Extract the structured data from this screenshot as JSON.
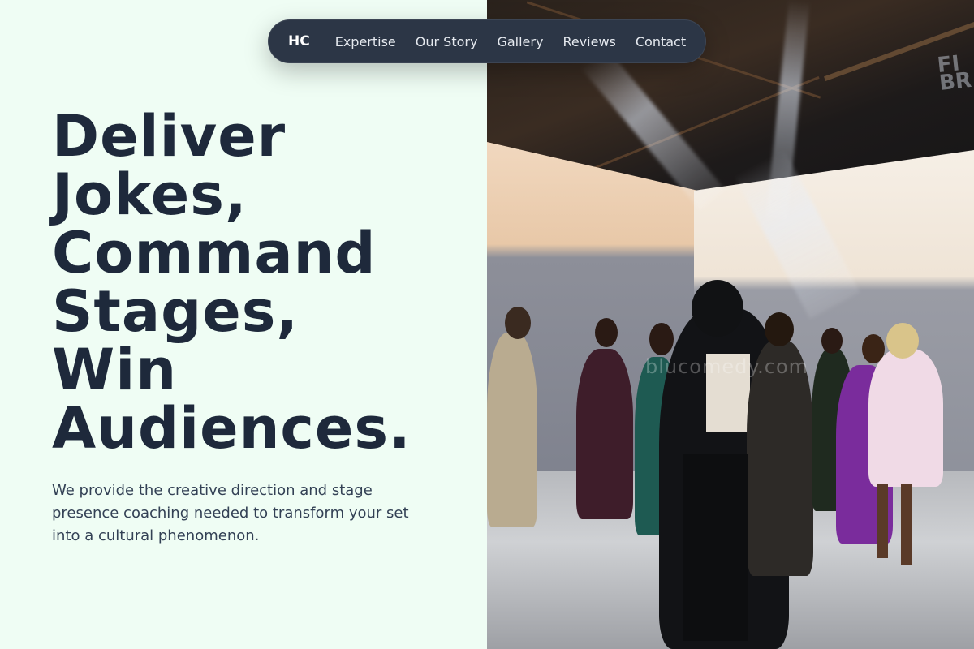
{
  "nav": {
    "logo": "HC",
    "links": [
      "Expertise",
      "Our Story",
      "Gallery",
      "Reviews",
      "Contact"
    ]
  },
  "hero": {
    "title_lines": [
      "Deliver",
      "Jokes,",
      "Command",
      "Stages,",
      "Win",
      "Audiences."
    ],
    "subtitle": "We provide the creative direction and stage presence coaching needed to transform your set into a cultural phenomenon."
  },
  "image": {
    "watermark": "blucomedy.com"
  },
  "colors": {
    "background": "#effdf4",
    "heading": "#1e293b",
    "body_text": "#334155",
    "nav_bg": "#2c3646",
    "nav_text": "#e5e9ef"
  }
}
